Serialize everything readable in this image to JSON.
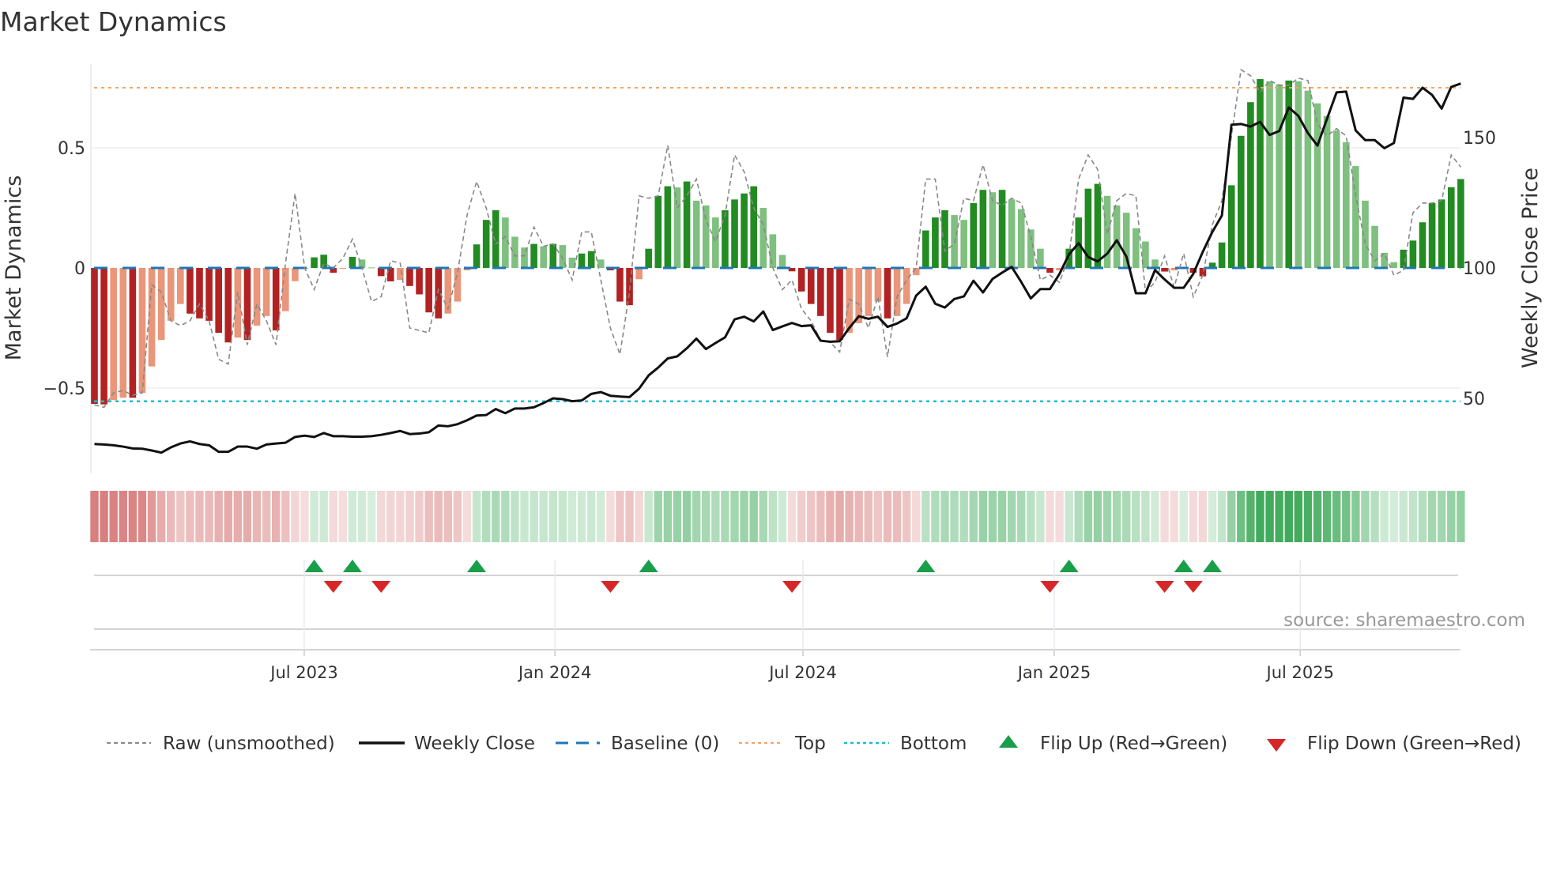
{
  "chart_data": {
    "type": "bar",
    "title": "Market Dynamics",
    "ylabel": "Market Dynamics",
    "ylabel_right": "Weekly Close Price",
    "ylim": [
      -0.62,
      0.85
    ],
    "ylim_right": [
      28,
      172
    ],
    "yticks": [
      {
        "value": 0.5,
        "label": "0.5"
      },
      {
        "value": 0,
        "label": "0"
      },
      {
        "value": -0.5,
        "label": "−0.5"
      }
    ],
    "yticks_right": [
      {
        "value": 150,
        "label": "150"
      },
      {
        "value": 100,
        "label": "100"
      },
      {
        "value": 50,
        "label": "50"
      }
    ],
    "xticks": [
      {
        "week": 22.96,
        "label": "Jul 2023"
      },
      {
        "week": 49.2,
        "label": "Jan 2024"
      },
      {
        "week": 75.15,
        "label": "Jul 2024"
      },
      {
        "week": 101.45,
        "label": "Jan 2025"
      },
      {
        "week": 127.2,
        "label": "Jul 2025"
      }
    ],
    "top_level": 0.75,
    "bottom_level": -0.555,
    "baseline": 0,
    "values": [
      -0.566,
      -0.568,
      -0.55,
      -0.54,
      -0.54,
      -0.52,
      -0.41,
      -0.3,
      -0.22,
      -0.15,
      -0.19,
      -0.21,
      -0.22,
      -0.27,
      -0.31,
      -0.29,
      -0.3,
      -0.24,
      -0.2,
      -0.26,
      -0.18,
      -0.055,
      -0.002,
      0.044,
      0.055,
      -0.02,
      -0.002,
      0.046,
      0.035,
      0.002,
      -0.034,
      -0.056,
      -0.05,
      -0.075,
      -0.11,
      -0.185,
      -0.21,
      -0.19,
      -0.14,
      -0.01,
      0.098,
      0.2,
      0.24,
      0.21,
      0.13,
      0.085,
      0.1,
      0.09,
      0.1,
      0.095,
      0.043,
      0.06,
      0.07,
      0.035,
      -0.01,
      -0.14,
      -0.155,
      -0.047,
      0.08,
      0.3,
      0.34,
      0.335,
      0.36,
      0.28,
      0.26,
      0.21,
      0.24,
      0.285,
      0.31,
      0.34,
      0.25,
      0.14,
      0.054,
      -0.014,
      -0.098,
      -0.15,
      -0.2,
      -0.27,
      -0.3,
      -0.27,
      -0.23,
      -0.2,
      -0.14,
      -0.21,
      -0.2,
      -0.15,
      -0.03,
      0.156,
      0.21,
      0.24,
      0.22,
      0.2,
      0.27,
      0.325,
      0.315,
      0.325,
      0.285,
      0.245,
      0.16,
      0.08,
      -0.02,
      -0.01,
      0.08,
      0.21,
      0.33,
      0.35,
      0.3,
      0.26,
      0.23,
      0.165,
      0.11,
      0.035,
      -0.015,
      -0.01,
      0.005,
      -0.02,
      -0.035,
      0.022,
      0.106,
      0.344,
      0.55,
      0.69,
      0.786,
      0.777,
      0.764,
      0.78,
      0.777,
      0.738,
      0.685,
      0.633,
      0.572,
      0.523,
      0.424,
      0.28,
      0.175,
      0.063,
      0.024,
      0.076,
      0.114,
      0.19,
      0.27,
      0.285,
      0.336,
      0.37
    ],
    "raw": [
      -0.57,
      -0.58,
      -0.52,
      -0.51,
      -0.53,
      -0.52,
      -0.07,
      -0.1,
      -0.22,
      -0.24,
      -0.22,
      -0.15,
      -0.22,
      -0.38,
      -0.4,
      -0.1,
      -0.32,
      -0.15,
      -0.22,
      -0.32,
      0.02,
      0.31,
      0.0,
      -0.09,
      0.02,
      0.0,
      0.04,
      0.12,
      0.0,
      -0.14,
      -0.12,
      0.03,
      0.02,
      -0.25,
      -0.26,
      -0.27,
      -0.09,
      -0.17,
      -0.02,
      0.22,
      0.36,
      0.25,
      0.1,
      0.13,
      0.05,
      0.05,
      0.17,
      0.09,
      0.1,
      0.04,
      -0.05,
      0.15,
      0.15,
      -0.05,
      -0.25,
      -0.36,
      -0.1,
      0.3,
      0.29,
      0.3,
      0.51,
      0.25,
      0.3,
      0.37,
      0.2,
      0.11,
      0.22,
      0.47,
      0.4,
      0.25,
      0.18,
      0.0,
      -0.09,
      -0.05,
      -0.17,
      -0.22,
      -0.3,
      -0.31,
      -0.35,
      -0.13,
      -0.15,
      -0.25,
      -0.12,
      -0.37,
      -0.12,
      -0.05,
      0.0,
      0.37,
      0.37,
      0.07,
      0.1,
      0.29,
      0.28,
      0.43,
      0.28,
      0.26,
      0.29,
      0.27,
      0.13,
      -0.05,
      -0.03,
      -0.06,
      0.05,
      0.37,
      0.47,
      0.41,
      0.14,
      0.28,
      0.31,
      0.3,
      -0.1,
      -0.06,
      0.05,
      -0.08,
      0.06,
      -0.12,
      -0.03,
      0.18,
      0.28,
      0.55,
      0.825,
      0.8,
      0.73,
      0.78,
      0.76,
      0.76,
      0.79,
      0.78,
      0.6,
      0.55,
      0.58,
      0.55,
      0.3,
      0.1,
      0.03,
      0.06,
      -0.03,
      -0.01,
      0.23,
      0.27,
      0.27,
      0.28,
      0.47,
      0.42
    ],
    "weekly_close": [
      32.5,
      32.3,
      32.0,
      31.5,
      30.8,
      30.7,
      30.0,
      29.2,
      31.2,
      32.7,
      33.5,
      32.5,
      32.0,
      29.5,
      29.5,
      31.5,
      31.5,
      30.7,
      32.3,
      32.7,
      33.0,
      35.2,
      35.7,
      35.2,
      36.7,
      35.5,
      35.5,
      35.3,
      35.3,
      35.5,
      36.0,
      36.7,
      37.5,
      36.3,
      36.5,
      37.0,
      39.6,
      39.3,
      40.1,
      41.6,
      43.4,
      43.6,
      45.9,
      44.3,
      46.1,
      46.1,
      46.6,
      48.2,
      50.0,
      49.7,
      48.9,
      49.2,
      51.7,
      52.4,
      51.0,
      50.7,
      50.5,
      53.7,
      58.8,
      61.8,
      65.3,
      66.1,
      69.2,
      72.9,
      68.9,
      71.2,
      73.4,
      80.3,
      81.3,
      79.5,
      83.3,
      76.2,
      77.6,
      78.9,
      77.7,
      78.0,
      72.1,
      71.7,
      71.9,
      77.0,
      81.5,
      80.5,
      81.3,
      77.4,
      78.7,
      80.7,
      89.4,
      92.8,
      86.3,
      84.8,
      88.1,
      89.1,
      95.1,
      90.6,
      95.8,
      98.2,
      100.4,
      94.6,
      88.3,
      91.9,
      91.9,
      97.7,
      105.2,
      109.5,
      104.2,
      102.5,
      105.5,
      110.6,
      104.4,
      90.3,
      90.3,
      99.2,
      95.6,
      92.4,
      92.4,
      97.7,
      106.2,
      113.8,
      120.1,
      154.9,
      155.2,
      154.2,
      156.0,
      151.0,
      152.5,
      161.5,
      158.3,
      151.7,
      146.9,
      157.2,
      167.3,
      167.6,
      152.7,
      149.0,
      149.0,
      145.9,
      147.9,
      165.3,
      164.8,
      169.1,
      166.3,
      161.1,
      169.4,
      170.7
    ],
    "flip_up_weeks": [
      24,
      28,
      41,
      59,
      88,
      103,
      115,
      118
    ],
    "flip_down_weeks": [
      26,
      31,
      55,
      74,
      101,
      113,
      116
    ],
    "legend": [
      {
        "key": "raw",
        "label": "Raw (unsmoothed)"
      },
      {
        "key": "close",
        "label": "Weekly Close"
      },
      {
        "key": "baseline",
        "label": "Baseline (0)"
      },
      {
        "key": "top",
        "label": "Top"
      },
      {
        "key": "bottom",
        "label": "Bottom"
      },
      {
        "key": "flip_up",
        "label": "Flip Up (Red→Green)"
      },
      {
        "key": "flip_down",
        "label": "Flip Down (Green→Red)"
      }
    ],
    "legend_position": "bottom",
    "annotation": "source: sharemaestro.com",
    "colors": {
      "neg_falling": "#b22222",
      "neg_rising": "#e9967a",
      "pos_rising": "#228b22",
      "pos_falling": "#7fbf7f",
      "raw": "#888888",
      "close": "#111111",
      "baseline": "#1f77b4",
      "top": "#f4a460",
      "bottom": "#17becf",
      "flip_up": "#1a9e4a",
      "flip_down": "#d62728"
    }
  }
}
